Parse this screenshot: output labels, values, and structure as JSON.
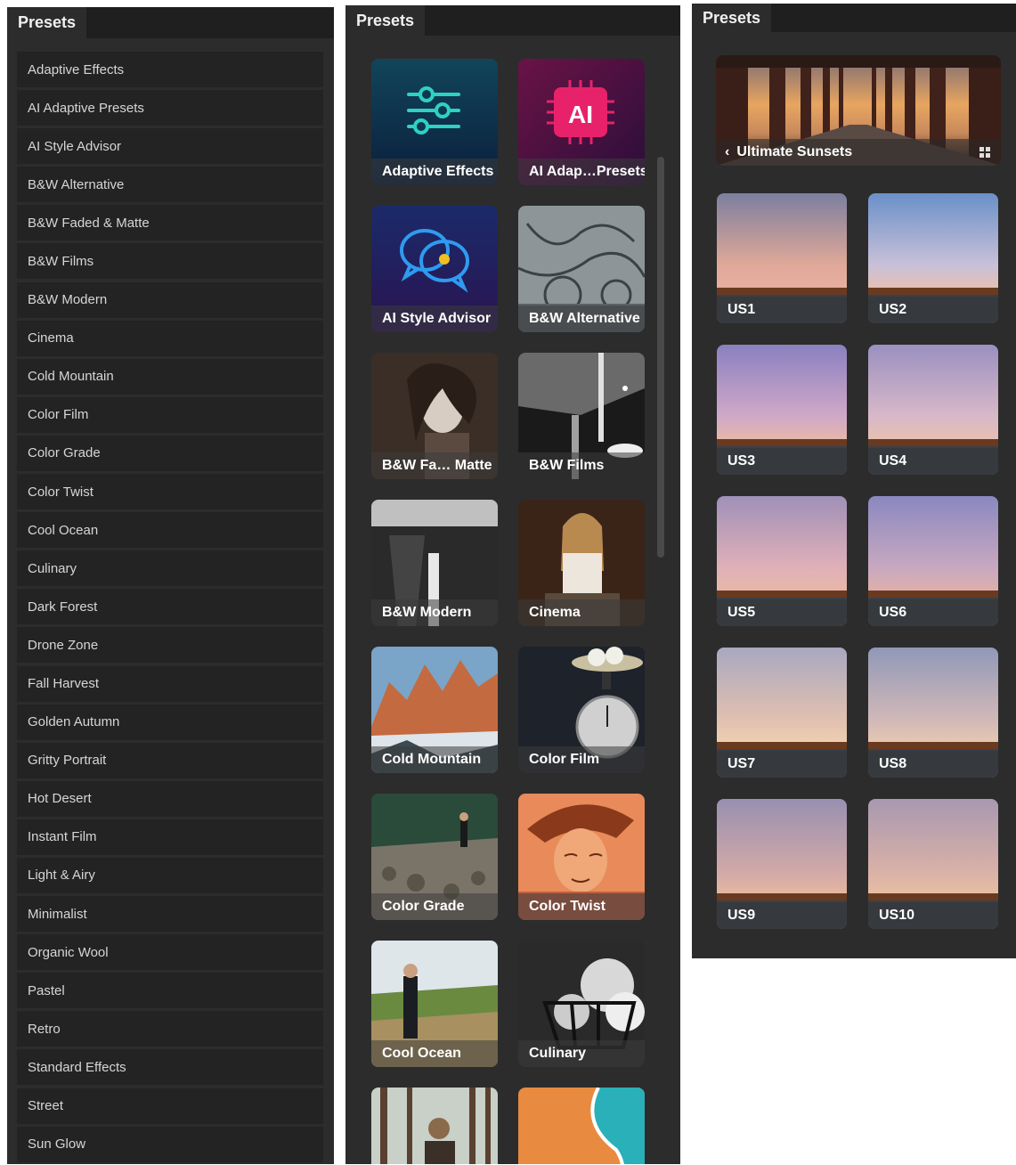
{
  "panel_list": {
    "tab_label": "Presets",
    "items": [
      "Adaptive Effects",
      "AI Adaptive Presets",
      "AI Style Advisor",
      "B&W Alternative",
      "B&W Faded & Matte",
      "B&W Films",
      "B&W Modern",
      "Cinema",
      "Cold Mountain",
      "Color Film",
      "Color Grade",
      "Color Twist",
      "Cool Ocean",
      "Culinary",
      "Dark Forest",
      "Drone Zone",
      "Fall Harvest",
      "Golden Autumn",
      "Gritty Portrait",
      "Hot Desert",
      "Instant Film",
      "Light & Airy",
      "Minimalist",
      "Organic Wool",
      "Pastel",
      "Retro",
      "Standard Effects",
      "Street",
      "Sun Glow"
    ]
  },
  "panel_grid": {
    "tab_label": "Presets",
    "ai_badge": "AI",
    "thumbs": [
      {
        "label": "Adaptive Effects",
        "icon": "sliders-icon"
      },
      {
        "label": "AI Adap…Presets",
        "icon": "ai-chip-icon"
      },
      {
        "label": "AI Style Advisor",
        "icon": "chat-bubbles-icon"
      },
      {
        "label": "B&W Alternative",
        "icon": "architecture-thumb"
      },
      {
        "label": "B&W Fa… Matte",
        "icon": "portrait-thumb"
      },
      {
        "label": "B&W Films",
        "icon": "bridge-thumb"
      },
      {
        "label": "B&W Modern",
        "icon": "waterfall-thumb"
      },
      {
        "label": "Cinema",
        "icon": "woman-thumb"
      },
      {
        "label": "Cold Mountain",
        "icon": "mountain-thumb"
      },
      {
        "label": "Color Film",
        "icon": "scale-thumb"
      },
      {
        "label": "Color Grade",
        "icon": "cliff-thumb"
      },
      {
        "label": "Color Twist",
        "icon": "hat-woman-thumb"
      },
      {
        "label": "Cool Ocean",
        "icon": "field-man-thumb"
      },
      {
        "label": "Culinary",
        "icon": "eggs-thumb"
      },
      {
        "label": "",
        "icon": "forest-man-thumb"
      },
      {
        "label": "",
        "icon": "beach-aerial-thumb"
      }
    ]
  },
  "panel_sunsets": {
    "tab_label": "Presets",
    "banner_label": "Ultimate Sunsets",
    "back_icon": "chevron-left-icon",
    "grid_icon": "grid-view-icon",
    "items": [
      "US1",
      "US2",
      "US3",
      "US4",
      "US5",
      "US6",
      "US7",
      "US8",
      "US9",
      "US10"
    ]
  },
  "colors": {
    "panel_bg": "#2c2c2c",
    "item_bg": "#232323",
    "tab_strip": "#1f1f1f",
    "ai_pink": "#e8226a"
  }
}
